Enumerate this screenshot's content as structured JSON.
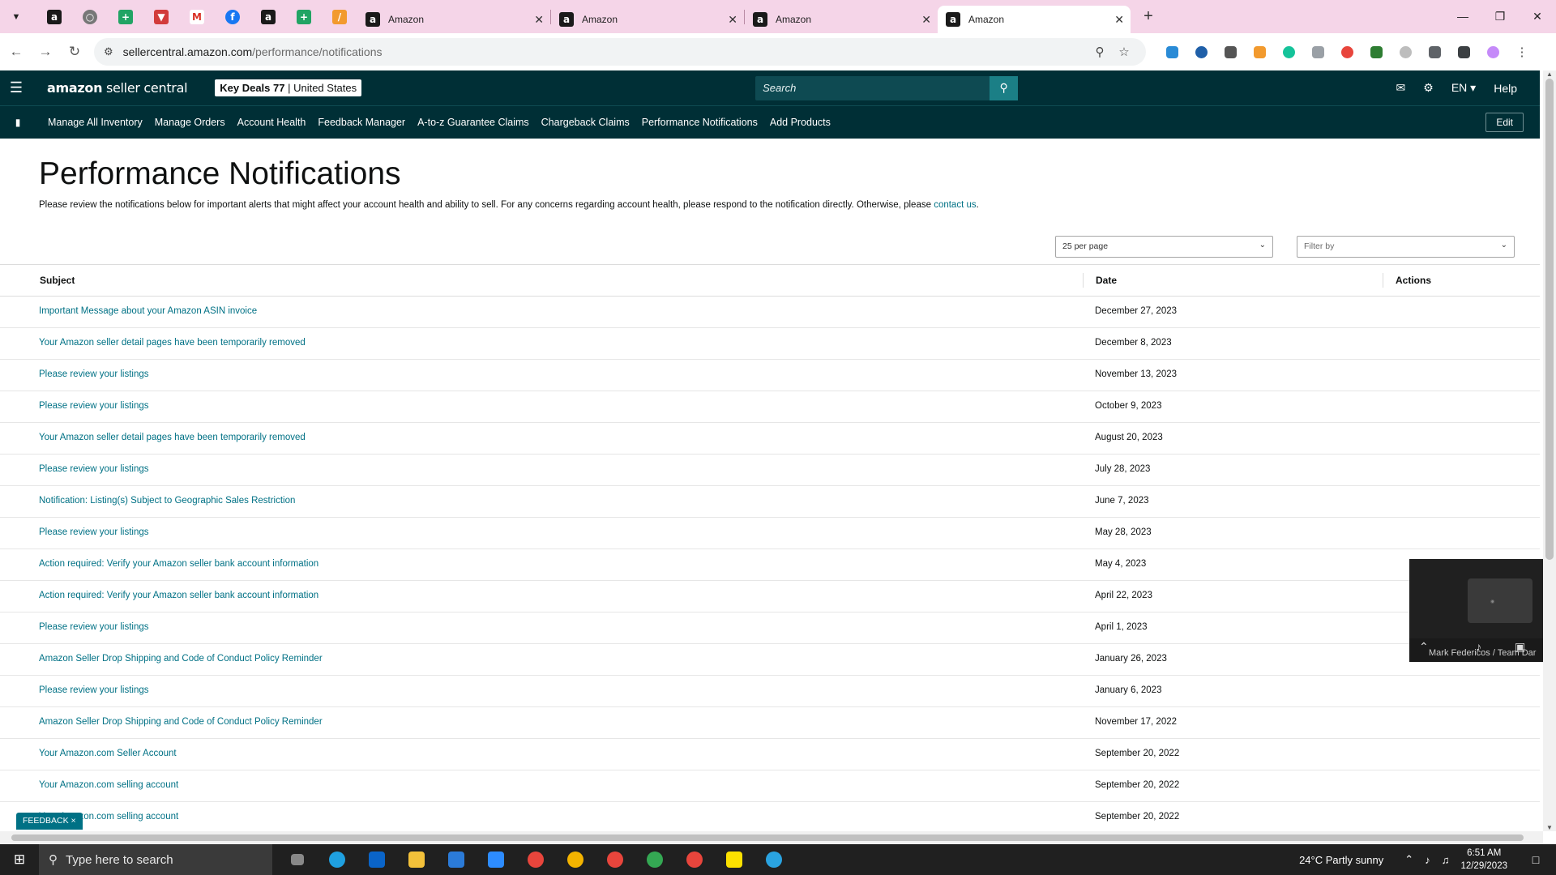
{
  "browser": {
    "tabs": [
      {
        "title": "Amazon",
        "active": false
      },
      {
        "title": "Amazon",
        "active": false
      },
      {
        "title": "Amazon",
        "active": false
      },
      {
        "title": "Amazon",
        "active": true
      }
    ],
    "url_host": "sellercentral.amazon.com",
    "url_path": "/performance/notifications"
  },
  "header": {
    "logo_bold": "amazon",
    "logo_rest": " seller central",
    "store_bold": "Key Deals 77",
    "store_sep": " | ",
    "store_region": "United States",
    "search_placeholder": "Search",
    "lang": "EN ▾",
    "help": "Help"
  },
  "nav": {
    "items": [
      "Manage All Inventory",
      "Manage Orders",
      "Account Health",
      "Feedback Manager",
      "A-to-z Guarantee Claims",
      "Chargeback Claims",
      "Performance Notifications",
      "Add Products"
    ],
    "edit": "Edit"
  },
  "page": {
    "title": "Performance Notifications",
    "intro": "Please review the notifications below for important alerts that might affect your account health and ability to sell. For any concerns regarding account health, please respond to the notification directly. Otherwise, please ",
    "intro_link": "contact us",
    "intro_end": ".",
    "per_page": "25 per page",
    "filter_placeholder": "Filter by"
  },
  "table": {
    "columns": [
      "Subject",
      "Date",
      "Actions"
    ],
    "rows": [
      {
        "subject": "Important Message about your Amazon ASIN invoice",
        "date": "December 27, 2023"
      },
      {
        "subject": "Your Amazon seller detail pages have been temporarily removed",
        "date": "December 8, 2023"
      },
      {
        "subject": "Please review your listings",
        "date": "November 13, 2023"
      },
      {
        "subject": "Please review your listings",
        "date": "October 9, 2023"
      },
      {
        "subject": "Your Amazon seller detail pages have been temporarily removed",
        "date": "August 20, 2023"
      },
      {
        "subject": "Please review your listings",
        "date": "July 28, 2023"
      },
      {
        "subject": "Notification: Listing(s) Subject to Geographic Sales Restriction",
        "date": "June 7, 2023"
      },
      {
        "subject": "Please review your listings",
        "date": "May 28, 2023"
      },
      {
        "subject": "Action required: Verify your Amazon seller bank account information",
        "date": "May 4, 2023"
      },
      {
        "subject": "Action required: Verify your Amazon seller bank account information",
        "date": "April 22, 2023"
      },
      {
        "subject": "Please review your listings",
        "date": "April 1, 2023"
      },
      {
        "subject": "Amazon Seller Drop Shipping and Code of Conduct Policy Reminder",
        "date": "January 26, 2023"
      },
      {
        "subject": "Please review your listings",
        "date": "January 6, 2023"
      },
      {
        "subject": "Amazon Seller Drop Shipping and Code of Conduct Policy Reminder",
        "date": "November 17, 2022"
      },
      {
        "subject": "Your Amazon.com Seller Account",
        "date": "September 20, 2022"
      },
      {
        "subject": "Your Amazon.com selling account",
        "date": "September 20, 2022"
      },
      {
        "subject": "Your Amazon.com selling account",
        "date": "September 20, 2022"
      }
    ]
  },
  "feedback": "FEEDBACK ×",
  "video": {
    "participant": "Mark Federicos / Team Dar"
  },
  "taskbar": {
    "search_placeholder": "Type here to search",
    "weather": "24°C  Partly sunny",
    "time": "6:51 AM",
    "date": "12/29/2023"
  },
  "colors": {
    "header_bg": "#002f36",
    "link": "#007185",
    "tabbar_bg": "#f5d5e8"
  }
}
